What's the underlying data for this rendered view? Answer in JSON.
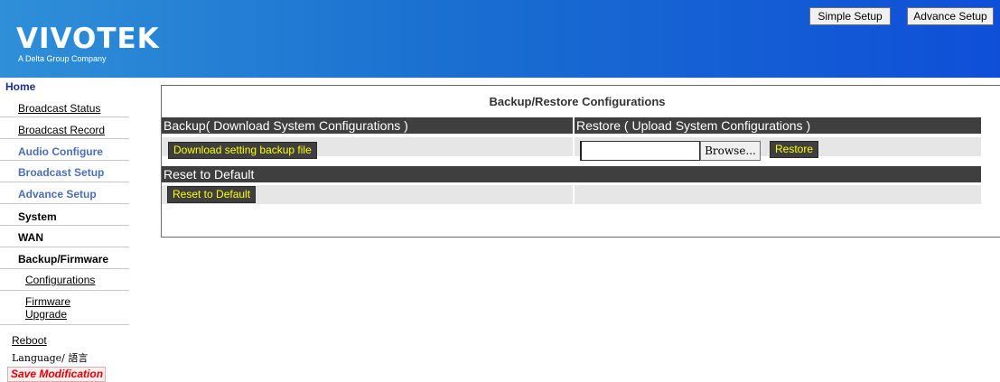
{
  "brand": {
    "name": "VIVOTEK",
    "tagline": "A Delta Group Company"
  },
  "top_buttons": {
    "simple": "Simple Setup",
    "advance": "Advance Setup"
  },
  "sidebar": {
    "home": "Home",
    "items": [
      {
        "label": "Broadcast Status"
      },
      {
        "label": "Broadcast Record"
      },
      {
        "label": "Audio Configure"
      },
      {
        "label": "Broadcast Setup"
      },
      {
        "label": "Advance Setup"
      },
      {
        "label": "System"
      },
      {
        "label": "WAN"
      },
      {
        "label": "Backup/Firmware"
      },
      {
        "label": "Configurations"
      },
      {
        "label": "Firmware Upgrade"
      },
      {
        "label": "Reboot"
      },
      {
        "label": "Language/ 語言"
      },
      {
        "label": "Save Modification"
      }
    ]
  },
  "main": {
    "title": "Backup/Restore Configurations",
    "backup_header": "Backup( Download System Configurations )",
    "restore_header": "Restore ( Upload System Configurations )",
    "download_button": "Download setting backup file",
    "browse_button": "Browse...",
    "restore_button": "Restore",
    "reset_header": "Reset to Default",
    "reset_button": "Reset to Default",
    "file_input_value": ""
  }
}
